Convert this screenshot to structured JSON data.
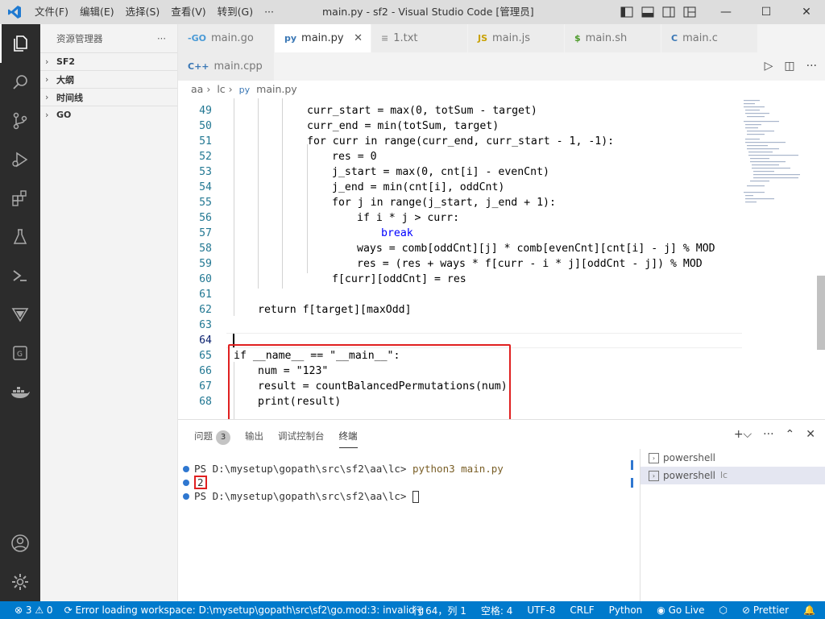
{
  "titlebar": {
    "menus": [
      "文件(F)",
      "编辑(E)",
      "选择(S)",
      "查看(V)",
      "转到(G)",
      "···"
    ],
    "title": "main.py - sf2 - Visual Studio Code [管理员]",
    "minimize": "—",
    "maximize": "☐",
    "close": "✕"
  },
  "sidebar": {
    "title": "资源管理器",
    "more": "···",
    "sections": [
      "SF2",
      "大纲",
      "时间线",
      "GO"
    ]
  },
  "tabs": [
    {
      "icon": "-GO",
      "label": "main.go"
    },
    {
      "icon": "py",
      "label": "main.py",
      "close": "✕"
    },
    {
      "icon": "≡",
      "label": "1.txt"
    },
    {
      "icon": "JS",
      "label": "main.js"
    },
    {
      "icon": "$",
      "label": "main.sh"
    },
    {
      "icon": "C",
      "label": "main.c"
    },
    {
      "icon": "C++",
      "label": "main.cpp"
    }
  ],
  "breadcrumb": [
    "aa",
    "lc",
    "main.py"
  ],
  "editor": {
    "lines": [
      {
        "n": "49",
        "text": "curr_start = max(0, totSum - target)"
      },
      {
        "n": "50",
        "text": "curr_end = min(totSum, target)"
      },
      {
        "n": "51",
        "text": "for curr in range(curr_end, curr_start - 1, -1):"
      },
      {
        "n": "52",
        "text": "res = 0"
      },
      {
        "n": "53",
        "text": "j_start = max(0, cnt[i] - evenCnt)"
      },
      {
        "n": "54",
        "text": "j_end = min(cnt[i], oddCnt)"
      },
      {
        "n": "55",
        "text": "for j in range(j_start, j_end + 1):"
      },
      {
        "n": "56",
        "text": "if i * j > curr:"
      },
      {
        "n": "57",
        "text": "break"
      },
      {
        "n": "58",
        "text": "ways = comb[oddCnt][j] * comb[evenCnt][cnt[i] - j] % MOD"
      },
      {
        "n": "59",
        "text": "res = (res + ways * f[curr - i * j][oddCnt - j]) % MOD"
      },
      {
        "n": "60",
        "text": "f[curr][oddCnt] = res"
      },
      {
        "n": "61",
        "text": ""
      },
      {
        "n": "62",
        "text": "return f[target][maxOdd]"
      },
      {
        "n": "63",
        "text": ""
      },
      {
        "n": "64",
        "text": ""
      },
      {
        "n": "65",
        "text": "if __name__ == \"__main__\":"
      },
      {
        "n": "66",
        "text": "num = \"123\""
      },
      {
        "n": "67",
        "text": "result = countBalancedPermutations(num)"
      },
      {
        "n": "68",
        "text": "print(result)"
      }
    ]
  },
  "panel": {
    "tabs": [
      "问题",
      "输出",
      "调试控制台",
      "终端"
    ],
    "problems_count": "3",
    "terminal_lines": [
      "PS D:\\mysetup\\gopath\\src\\sf2\\aa\\lc> ",
      "2",
      "PS D:\\mysetup\\gopath\\src\\sf2\\aa\\lc> "
    ],
    "command": "python3 main.py",
    "terminals": [
      {
        "name": "powershell",
        "sub": ""
      },
      {
        "name": "powershell",
        "sub": "lc"
      }
    ]
  },
  "statusbar": {
    "errors": "⊗ 3",
    "warnings": "⚠ 0",
    "workspace_error": "Error loading workspace: D:\\mysetup\\gopath\\src\\sf2\\go.mod:3: invalid g",
    "position": "行 64，列 1",
    "spaces": "空格: 4",
    "encoding": "UTF-8",
    "eol": "CRLF",
    "language": "Python",
    "golive": "Go Live",
    "prettier": "Prettier"
  },
  "colors": {
    "accent": "#007acc",
    "highlight": "#e02020"
  }
}
